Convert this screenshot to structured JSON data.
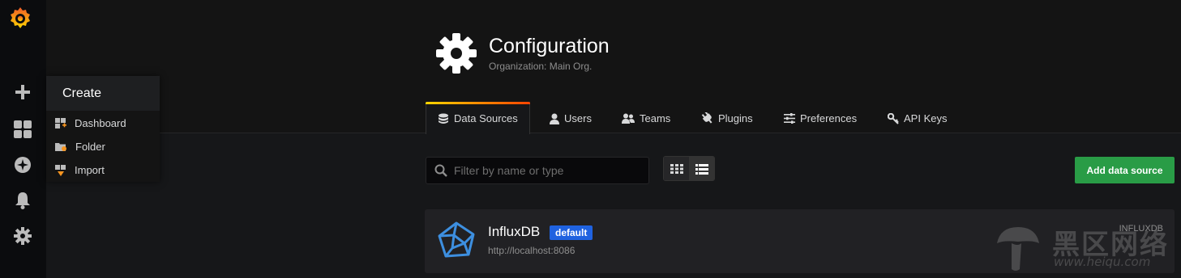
{
  "sidebar": {
    "items": [
      {
        "icon": "plus-icon"
      },
      {
        "icon": "dashboards-icon"
      },
      {
        "icon": "explore-icon"
      },
      {
        "icon": "bell-icon"
      },
      {
        "icon": "gear-icon"
      }
    ]
  },
  "create_menu": {
    "title": "Create",
    "items": [
      {
        "label": "Dashboard",
        "icon": "dashboard-add-icon"
      },
      {
        "label": "Folder",
        "icon": "folder-add-icon"
      },
      {
        "label": "Import",
        "icon": "import-icon"
      }
    ]
  },
  "page": {
    "title": "Configuration",
    "subtitle": "Organization: Main Org."
  },
  "tabs": [
    {
      "label": "Data Sources",
      "icon": "database-icon",
      "active": true
    },
    {
      "label": "Users",
      "icon": "user-icon"
    },
    {
      "label": "Teams",
      "icon": "users-icon"
    },
    {
      "label": "Plugins",
      "icon": "plug-icon"
    },
    {
      "label": "Preferences",
      "icon": "sliders-icon"
    },
    {
      "label": "API Keys",
      "icon": "key-icon"
    }
  ],
  "toolbar": {
    "filter_placeholder": "Filter by name or type",
    "add_label": "Add data source"
  },
  "datasources": [
    {
      "name": "InfluxDB",
      "badge": "default",
      "url": "http://localhost:8086",
      "type": "INFLUXDB"
    }
  ],
  "watermark": {
    "cn": "黑区网络",
    "url": "www.heiqu.com"
  },
  "colors": {
    "accent_green": "#299c46",
    "badge_blue": "#1f62e0",
    "tab_gradient_start": "#ffd500",
    "tab_gradient_end": "#ff4400"
  }
}
